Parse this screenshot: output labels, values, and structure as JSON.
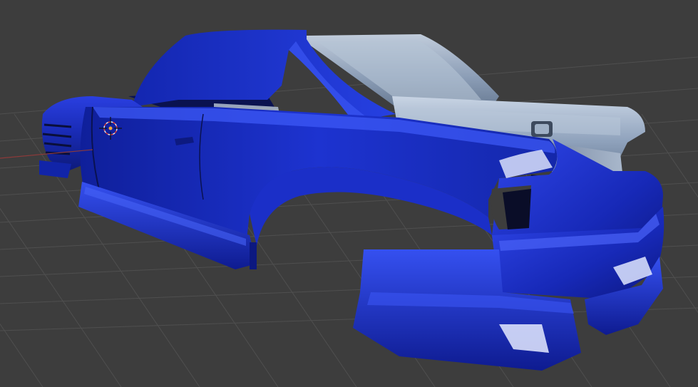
{
  "viewport": {
    "background": "#3d3d3d",
    "grid_color": "#4f4f4f",
    "axis_x_color": "#8c3a3a",
    "model_primary_color": "#1d2fc4",
    "model_secondary_color": "#9fb0c8"
  },
  "scene": {
    "object": "car-body-shell",
    "shading": "glossy",
    "origin_marker": "3d-cursor"
  }
}
